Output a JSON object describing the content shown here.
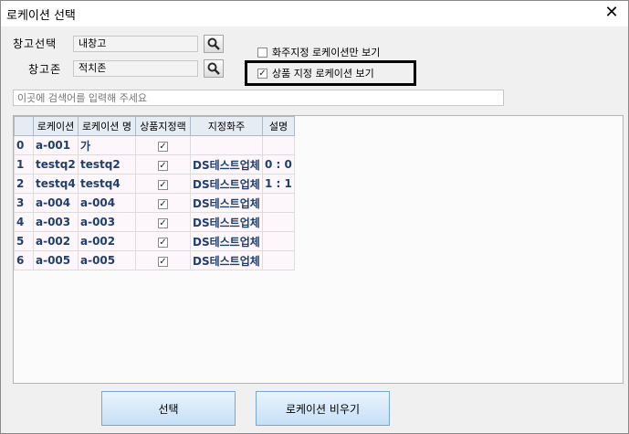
{
  "window": {
    "title": "로케이션 선택",
    "close_glyph": "✕"
  },
  "form": {
    "warehouse_label": "창고선택",
    "warehouse_value": "내창고",
    "zone_label": "창고존",
    "zone_value": "적치존"
  },
  "options": {
    "owner_only_label": "화주지정 로케이션만 보기",
    "owner_only_checked": false,
    "product_loc_label": "상품 지정 로케이션 보기",
    "product_loc_checked": true
  },
  "search": {
    "placeholder": "이곳에 검색어를 입력해 주세요"
  },
  "grid": {
    "columns": [
      "",
      "로케이션",
      "로케이션 명",
      "상품지정랙",
      "지정화주",
      "설명"
    ],
    "rows": [
      {
        "idx": "0",
        "code": "a-001",
        "name": "가",
        "checked": true,
        "owner": "",
        "desc": ""
      },
      {
        "idx": "1",
        "code": "testq2",
        "name": "testq2",
        "checked": true,
        "owner": "DS테스트업체",
        "desc": "0 : 0"
      },
      {
        "idx": "2",
        "code": "testq4",
        "name": "testq4",
        "checked": true,
        "owner": "DS테스트업체",
        "desc": "1 : 1"
      },
      {
        "idx": "3",
        "code": "a-004",
        "name": "a-004",
        "checked": true,
        "owner": "DS테스트업체",
        "desc": ""
      },
      {
        "idx": "4",
        "code": "a-003",
        "name": "a-003",
        "checked": true,
        "owner": "DS테스트업체",
        "desc": ""
      },
      {
        "idx": "5",
        "code": "a-002",
        "name": "a-002",
        "checked": true,
        "owner": "DS테스트업체",
        "desc": ""
      },
      {
        "idx": "6",
        "code": "a-005",
        "name": "a-005",
        "checked": true,
        "owner": "DS테스트업체",
        "desc": ""
      }
    ]
  },
  "buttons": {
    "select_label": "선택",
    "clear_label": "로케이션 비우기"
  },
  "icons": {
    "search": "magnifier-icon",
    "close": "close-icon",
    "check": "✓"
  }
}
